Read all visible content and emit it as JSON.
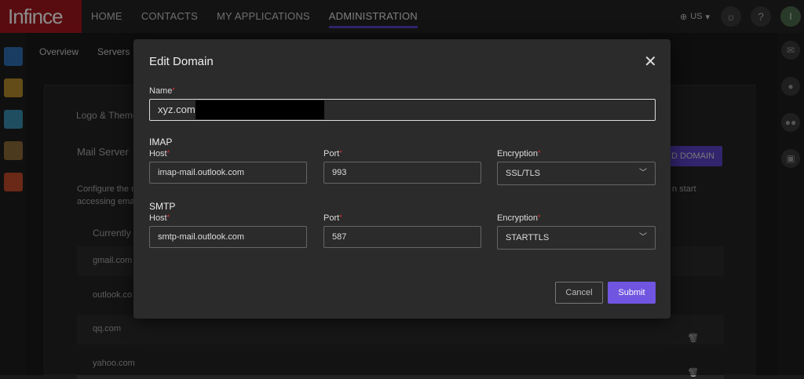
{
  "app": {
    "logo": "Infince"
  },
  "nav": [
    "HOME",
    "CONTACTS",
    "MY APPLICATIONS",
    "ADMINISTRATION"
  ],
  "nav_active": "ADMINISTRATION",
  "topright": {
    "lang": "US",
    "help": "?",
    "avatar": "I"
  },
  "subnav": [
    "Overview",
    "Servers"
  ],
  "background": {
    "logo_tab": "Logo & Theme",
    "card_title": "Mail Server",
    "add_domain": "D DOMAIN",
    "desc_line1": "Configure the m",
    "desc_line2": "accessing ema",
    "desc_right": "n start",
    "currently": "Currently",
    "domains": [
      "gmail.com",
      "outlook.co",
      "qq.com",
      "yahoo.com"
    ]
  },
  "modal": {
    "title": "Edit Domain",
    "close": "✕",
    "name_label": "Name",
    "name_value": "xyz.com",
    "imap": {
      "section": "IMAP",
      "host_label": "Host",
      "host_value": "imap-mail.outlook.com",
      "port_label": "Port",
      "port_value": "993",
      "enc_label": "Encryption",
      "enc_value": "SSL/TLS"
    },
    "smtp": {
      "section": "SMTP",
      "host_label": "Host",
      "host_value": "smtp-mail.outlook.com",
      "port_label": "Port",
      "port_value": "587",
      "enc_label": "Encryption",
      "enc_value": "STARTTLS"
    },
    "cancel": "Cancel",
    "submit": "Submit"
  },
  "colors": {
    "accent": "#6f55e0",
    "brand": "#a3171c"
  }
}
